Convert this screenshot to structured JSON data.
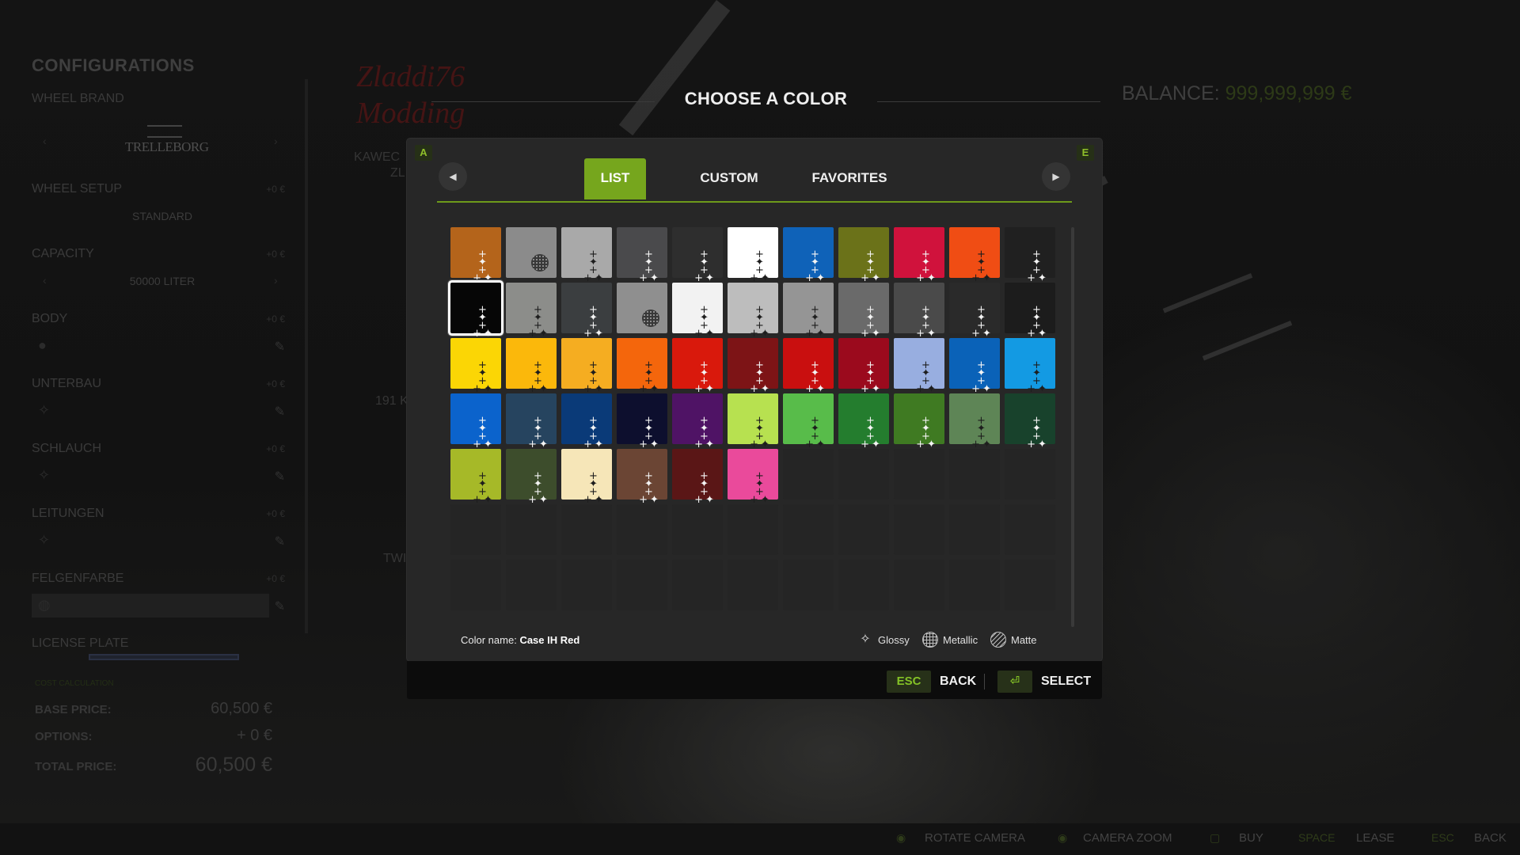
{
  "config": {
    "title": "CONFIGURATIONS",
    "sections": [
      {
        "label": "WHEEL BRAND",
        "price": "",
        "value": ""
      },
      {
        "label": "WHEEL SETUP",
        "price": "+0 €",
        "value": "STANDARD"
      },
      {
        "label": "CAPACITY",
        "price": "+0 €",
        "value": "50000 LITER"
      },
      {
        "label": "BODY",
        "price": "+0 €",
        "value": ""
      },
      {
        "label": "UNTERBAU",
        "price": "+0 €",
        "value": ""
      },
      {
        "label": "SCHLAUCH",
        "price": "+0 €",
        "value": ""
      },
      {
        "label": "LEITUNGEN",
        "price": "+0 €",
        "value": ""
      },
      {
        "label": "FELGENFARBE",
        "price": "+0 €",
        "value": ""
      },
      {
        "label": "LICENSE PLATE",
        "price": "",
        "value": ""
      }
    ],
    "brand_logo": "TRELLEBORG",
    "cost_heading": "COST CALCULATION",
    "base_price_label": "BASE PRICE:",
    "base_price": "60,500 €",
    "options_label": "OPTIONS:",
    "options_price": "+ 0 €",
    "total_label": "TOTAL PRICE:",
    "total_price": "60,500 €"
  },
  "background": {
    "watermark_line1": "Zladdi76",
    "watermark_line2": "Modding",
    "ghost_texts": [
      "KAWEC",
      "ZL",
      "191 K",
      "TWI"
    ],
    "balance_label": "BALANCE:",
    "balance_value": "999,999,999 €"
  },
  "dialog": {
    "title": "CHOOSE A COLOR",
    "left_key": "A",
    "right_key": "E",
    "tabs": [
      {
        "label": "LIST",
        "active": true
      },
      {
        "label": "CUSTOM",
        "active": false
      },
      {
        "label": "FAVORITES",
        "active": false
      }
    ],
    "swatch_rows": [
      [
        {
          "color": "#b4641b",
          "finish": "glossy",
          "sparkle": "light"
        },
        {
          "color": "#8b8b8b",
          "finish": "metallic",
          "sparkle": "dark"
        },
        {
          "color": "#a9a9a9",
          "finish": "glossy",
          "sparkle": "dark"
        },
        {
          "color": "#4a4a4c",
          "finish": "glossy",
          "sparkle": "light"
        },
        {
          "color": "#2e2e2e",
          "finish": "glossy",
          "sparkle": "light"
        },
        {
          "color": "#ffffff",
          "finish": "glossy",
          "sparkle": "dark"
        },
        {
          "color": "#0f62b8",
          "finish": "glossy",
          "sparkle": "light"
        },
        {
          "color": "#6b7219",
          "finish": "glossy",
          "sparkle": "light"
        },
        {
          "color": "#d0123c",
          "finish": "glossy",
          "sparkle": "light"
        },
        {
          "color": "#f04d14",
          "finish": "glossy",
          "sparkle": "dark"
        },
        {
          "color": "#202020",
          "finish": "glossy",
          "sparkle": "light"
        }
      ],
      [
        {
          "color": "#060606",
          "finish": "glossy",
          "sparkle": "light",
          "selected": true
        },
        {
          "color": "#8c8d8a",
          "finish": "glossy",
          "sparkle": "dark"
        },
        {
          "color": "#3b3e40",
          "finish": "glossy",
          "sparkle": "light"
        },
        {
          "color": "#8f8f8f",
          "finish": "metallic",
          "sparkle": "dark"
        },
        {
          "color": "#f2f2f2",
          "finish": "glossy",
          "sparkle": "dark"
        },
        {
          "color": "#bdbdbd",
          "finish": "glossy",
          "sparkle": "dark"
        },
        {
          "color": "#959595",
          "finish": "glossy",
          "sparkle": "dark"
        },
        {
          "color": "#6a6a6a",
          "finish": "glossy",
          "sparkle": "light"
        },
        {
          "color": "#4a4a4a",
          "finish": "glossy",
          "sparkle": "light"
        },
        {
          "color": "#2a2a2a",
          "finish": "glossy",
          "sparkle": "light"
        },
        {
          "color": "#1c1c1c",
          "finish": "glossy",
          "sparkle": "light"
        }
      ],
      [
        {
          "color": "#fbd605",
          "finish": "glossy",
          "sparkle": "dark"
        },
        {
          "color": "#fbb80b",
          "finish": "glossy",
          "sparkle": "dark"
        },
        {
          "color": "#f5ad21",
          "finish": "glossy",
          "sparkle": "dark"
        },
        {
          "color": "#f4660c",
          "finish": "glossy",
          "sparkle": "dark"
        },
        {
          "color": "#d9190c",
          "finish": "glossy",
          "sparkle": "light"
        },
        {
          "color": "#7d1416",
          "finish": "glossy",
          "sparkle": "light"
        },
        {
          "color": "#c90f0f",
          "finish": "glossy",
          "sparkle": "light"
        },
        {
          "color": "#9b0a1d",
          "finish": "glossy",
          "sparkle": "light"
        },
        {
          "color": "#98aee0",
          "finish": "glossy",
          "sparkle": "dark"
        },
        {
          "color": "#0a62b8",
          "finish": "glossy",
          "sparkle": "light"
        },
        {
          "color": "#139ae3",
          "finish": "glossy",
          "sparkle": "dark"
        }
      ],
      [
        {
          "color": "#0b63cc",
          "finish": "glossy",
          "sparkle": "light"
        },
        {
          "color": "#26445f",
          "finish": "glossy",
          "sparkle": "light"
        },
        {
          "color": "#0a3a78",
          "finish": "glossy",
          "sparkle": "light"
        },
        {
          "color": "#0d0f2e",
          "finish": "glossy",
          "sparkle": "light"
        },
        {
          "color": "#4f1365",
          "finish": "glossy",
          "sparkle": "light"
        },
        {
          "color": "#b7e150",
          "finish": "glossy",
          "sparkle": "dark"
        },
        {
          "color": "#58bc4a",
          "finish": "glossy",
          "sparkle": "dark"
        },
        {
          "color": "#247d2e",
          "finish": "glossy",
          "sparkle": "light"
        },
        {
          "color": "#3f7a22",
          "finish": "glossy",
          "sparkle": "light"
        },
        {
          "color": "#5e8556",
          "finish": "glossy",
          "sparkle": "dark"
        },
        {
          "color": "#18422c",
          "finish": "glossy",
          "sparkle": "light"
        }
      ],
      [
        {
          "color": "#a6b928",
          "finish": "glossy",
          "sparkle": "dark"
        },
        {
          "color": "#3d4d2c",
          "finish": "glossy",
          "sparkle": "light"
        },
        {
          "color": "#f6e6b8",
          "finish": "glossy",
          "sparkle": "dark"
        },
        {
          "color": "#6b4534",
          "finish": "glossy",
          "sparkle": "light"
        },
        {
          "color": "#5a1616",
          "finish": "glossy",
          "sparkle": "light"
        },
        {
          "color": "#ea4a9b",
          "finish": "glossy",
          "sparkle": "dark"
        }
      ]
    ],
    "color_name_label": "Color name:",
    "color_name_value": "Case IH Red",
    "legend": [
      {
        "label": "Glossy",
        "icon": "glossy-icon"
      },
      {
        "label": "Metallic",
        "icon": "metallic-icon"
      },
      {
        "label": "Matte",
        "icon": "matte-icon"
      }
    ],
    "back_key": "ESC",
    "back_label": "BACK",
    "select_key_icon": "enter-icon",
    "select_label": "SELECT"
  },
  "status_bar": [
    {
      "key": "",
      "label": "ROTATE CAMERA"
    },
    {
      "key": "",
      "label": "CAMERA ZOOM"
    },
    {
      "key": "",
      "label": "BUY"
    },
    {
      "key": "SPACE",
      "label": "LEASE"
    },
    {
      "key": "ESC",
      "label": "BACK"
    }
  ],
  "colors": {
    "accent": "#76a61d",
    "dialog_bg": "#272727",
    "bottom_bar_bg": "#0c0c0c"
  }
}
